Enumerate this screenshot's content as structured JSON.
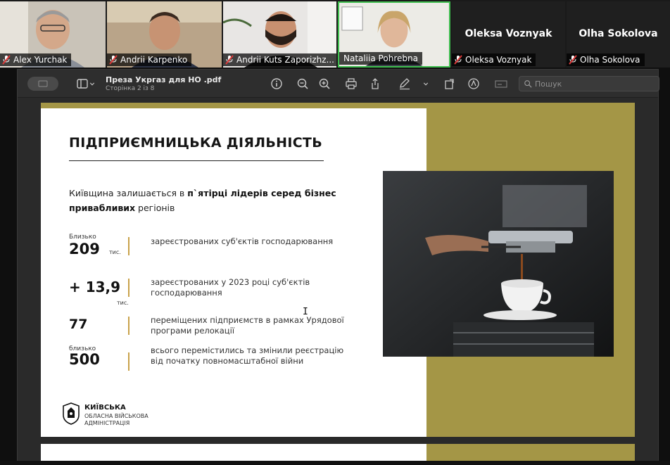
{
  "participants": [
    {
      "name": "Alex Yurchak",
      "video": true,
      "muted": true
    },
    {
      "name": "Andrii Karpenko",
      "video": true,
      "muted": true
    },
    {
      "name": "Andrii Kuts Zaporizhz...",
      "video": true,
      "muted": true
    },
    {
      "name": "Nataliia Pohrebna",
      "video": true,
      "muted": false
    },
    {
      "name": "Oleksa Voznyak",
      "video": false,
      "muted": true
    },
    {
      "name": "Olha Sokolova",
      "video": false,
      "muted": true
    }
  ],
  "viewer": {
    "doc_title": "Преза Укргаз для НО .pdf",
    "page_info": "Сторінка 2 із 8",
    "search_placeholder": "Пошук"
  },
  "slide": {
    "title": "ПІДПРИЄМНИЦЬКА ДІЯЛЬНІСТЬ",
    "lead_part1": "Київщина залишається в ",
    "lead_bold1": "п`ятірці лідерів серед бізнес привабливих",
    "lead_part2": " регіонів",
    "stats": [
      {
        "pre": "Близько",
        "number": "209",
        "unit": "тис.",
        "desc": "зареєстрованих суб'єктів господарювання"
      },
      {
        "pre": "",
        "number": "+ 13,9",
        "unit": "тис.",
        "desc": "зареєстрованих у 2023 році суб'єктів господарювання"
      },
      {
        "pre": "",
        "number": "77",
        "unit": "",
        "desc": "переміщених підприємств в рамках Урядової програми релокації"
      },
      {
        "pre": "близько",
        "number": "500",
        "unit": "",
        "desc": "всього перемістились та змінили реєстрацію від початку повномасштабної війни"
      }
    ],
    "logo_line1": "КИЇВСЬКА",
    "logo_line2": "ОБЛАСНА ВІЙСЬКОВА",
    "logo_line3": "АДМІНІСТРАЦІЯ"
  },
  "colors": {
    "gold": "#a49646",
    "accent_bar": "#c9a24a",
    "muted_mic": "#e03a3a"
  }
}
